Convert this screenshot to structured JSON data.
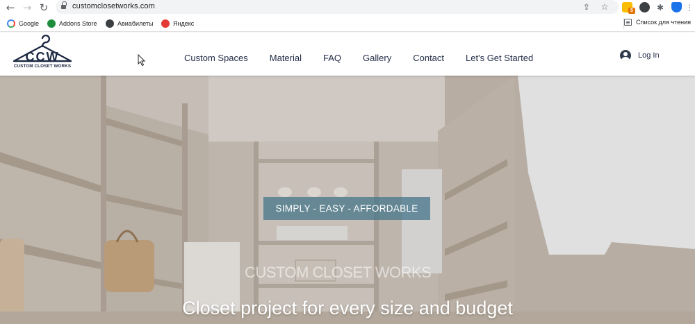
{
  "browser": {
    "url": "customclosetworks.com",
    "bookmarks": [
      {
        "label": "Google",
        "icon": "google-icon",
        "color": "#4285f4"
      },
      {
        "label": "Addons Store",
        "icon": "addons-store-icon",
        "color": "#1e8e3e"
      },
      {
        "label": "Авиабилеты",
        "icon": "aviabilety-icon",
        "color": "#3c4043"
      },
      {
        "label": "Яндекс",
        "icon": "yandex-icon",
        "color": "#e53935"
      }
    ],
    "reading_list_label": "Список для чтения",
    "extension_badge": "5"
  },
  "site": {
    "logo": {
      "mark": "CCW",
      "name": "CUSTOM CLOSET WORKS"
    },
    "nav": [
      {
        "label": "Custom Spaces"
      },
      {
        "label": "Material"
      },
      {
        "label": "FAQ"
      },
      {
        "label": "Gallery"
      },
      {
        "label": "Contact"
      },
      {
        "label": "Let's Get Started"
      }
    ],
    "login_label": "Log In",
    "colors": {
      "brand": "#1f2a44",
      "tagline_bg": "#4a788c"
    }
  },
  "hero": {
    "tagline": "SIMPLY - EASY - AFFORDABLE",
    "watermark": "CUSTOM CLOSET WORKS",
    "headline": "Closet project for every size and budget"
  }
}
